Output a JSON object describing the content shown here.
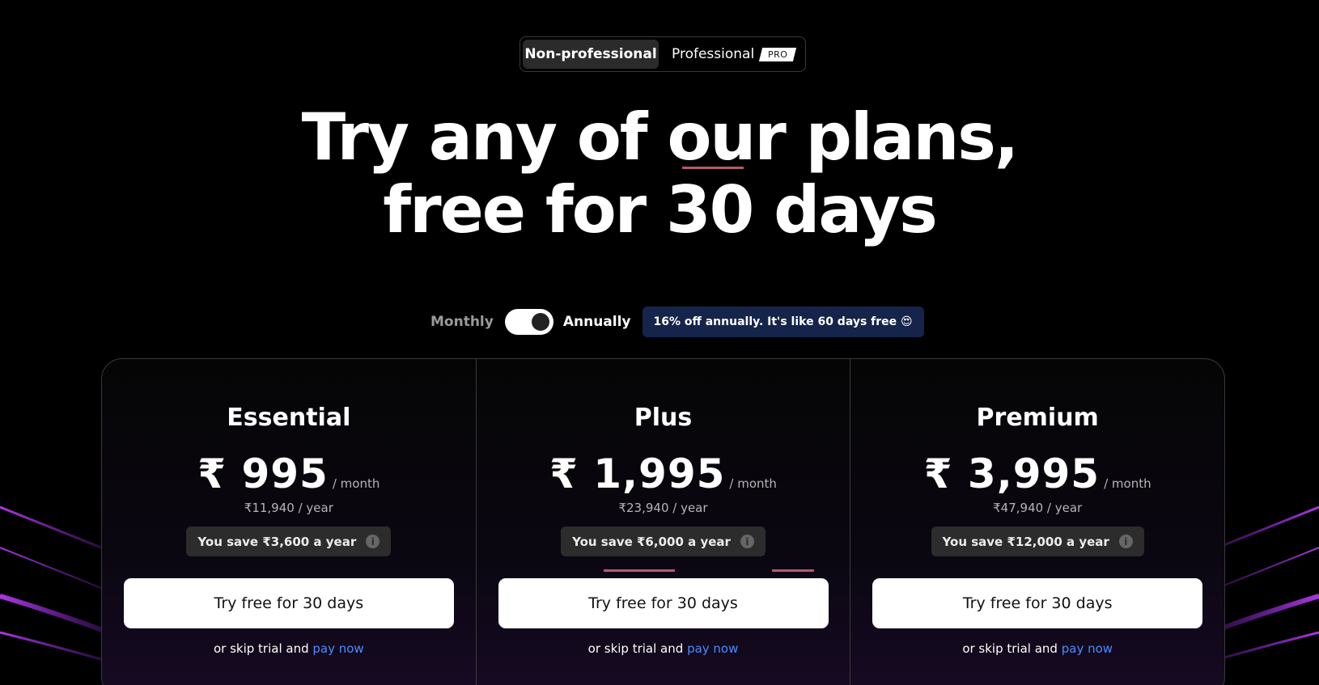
{
  "audience_toggle": {
    "options": [
      {
        "label": "Non-professional",
        "active": true
      },
      {
        "label": "Professional",
        "active": false
      }
    ],
    "pro_badge": "PRO"
  },
  "headline": {
    "line1": "Try any of our plans,",
    "line2": "free for 30 days"
  },
  "billing": {
    "monthly_label": "Monthly",
    "annually_label": "Annually",
    "selected": "Annually",
    "discount_text": "16% off annually. It's like 60 days free 😍"
  },
  "plans": [
    {
      "name": "Essential",
      "price": "₹ 995",
      "per_month": "/ month",
      "per_year": "₹11,940 / year",
      "savings": "You save ₹3,600 a year",
      "cta": "Try free for 30 days",
      "skip_prefix": "or skip trial and",
      "pay_link": "pay now"
    },
    {
      "name": "Plus",
      "price": "₹ 1,995",
      "per_month": "/ month",
      "per_year": "₹23,940 / year",
      "savings": "You save ₹6,000 a year",
      "cta": "Try free for 30 days",
      "skip_prefix": "or skip trial and",
      "pay_link": "pay now"
    },
    {
      "name": "Premium",
      "price": "₹ 3,995",
      "per_month": "/ month",
      "per_year": "₹47,940 / year",
      "savings": "You save ₹12,000 a year",
      "cta": "Try free for 30 days",
      "skip_prefix": "or skip trial and",
      "pay_link": "pay now"
    }
  ],
  "colors": {
    "background": "#000000",
    "accent_link": "#4a8cff",
    "discount_pill": "#15244a",
    "savings_pill": "#2c2c2c",
    "underline_accent": "#b45a6c"
  },
  "icons": {
    "info": "info-icon",
    "discount_emoji": "heart-eyes-emoji"
  }
}
